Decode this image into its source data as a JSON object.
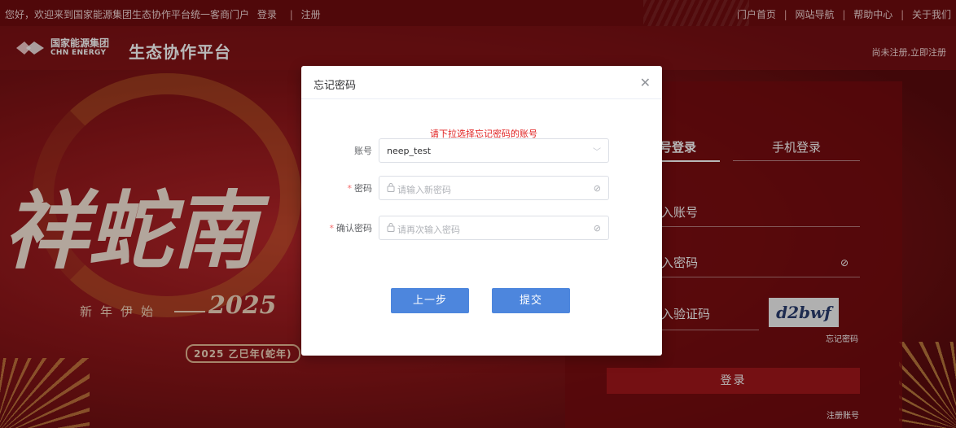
{
  "topbar": {
    "greeting": "您好，欢迎来到国家能源集团生态协作平台统一客商门户",
    "login": "登录",
    "register": "注册",
    "nav": [
      "门户首页",
      "网站导航",
      "帮助中心",
      "关于我们"
    ]
  },
  "header": {
    "logo_cn": "国家能源集团",
    "logo_en": "CHN ENERGY",
    "platform_title": "生态协作平台",
    "register_link": "尚未注册,立即注册"
  },
  "hero": {
    "calligraphy": "祥蛇南",
    "new_year": "新年伊始",
    "year_script": "2025",
    "year_badge": "2025 乙巳年(蛇年)"
  },
  "login_panel": {
    "tab_account": "号登录",
    "tab_phone": "手机登录",
    "account_placeholder": "​入账号",
    "password_placeholder": "​入密码",
    "captcha_placeholder": "​入验证码",
    "captcha_text": "d2bwf",
    "forgot_password": "忘记密码",
    "login_button": "登录",
    "register_account": "注册账号"
  },
  "modal": {
    "title": "忘记密码",
    "hint": "请下拉选择忘记密码的账号",
    "account_label": "账号",
    "account_value": "neep_test",
    "password_label": "密码",
    "password_placeholder": "请输入新密码",
    "confirm_label": "确认密码",
    "confirm_placeholder": "请再次输入密码",
    "required_mark": "*",
    "prev_button": "上一步",
    "submit_button": "提交"
  },
  "colors": {
    "brand_red": "#a3171b",
    "button_blue": "#4d86dd",
    "hint_red": "#e02020"
  }
}
